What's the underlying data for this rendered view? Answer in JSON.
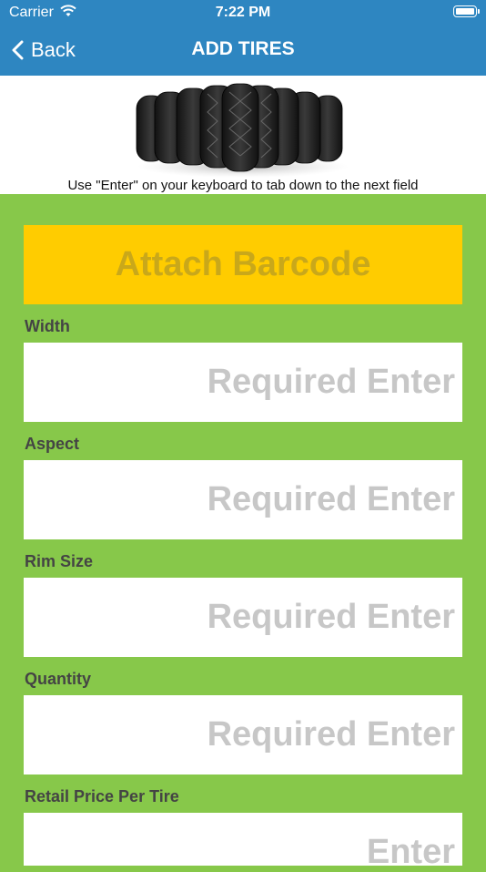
{
  "status_bar": {
    "carrier": "Carrier",
    "time": "7:22 PM"
  },
  "nav": {
    "back_label": "Back",
    "title": "ADD TIRES"
  },
  "hint": "Use \"Enter\" on your keyboard to tab down to the next field",
  "barcode_button": "Attach Barcode",
  "fields": [
    {
      "label": "Width",
      "placeholder": "Required Enter",
      "value": ""
    },
    {
      "label": "Aspect",
      "placeholder": "Required Enter",
      "value": ""
    },
    {
      "label": "Rim Size",
      "placeholder": "Required Enter",
      "value": ""
    },
    {
      "label": "Quantity",
      "placeholder": "Required Enter",
      "value": ""
    },
    {
      "label": "Retail Price Per Tire",
      "placeholder": "Enter",
      "value": ""
    }
  ],
  "colors": {
    "nav": "#2e86c1",
    "background": "#87c84a",
    "barcode_button": "#ffcc00",
    "barcode_text": "#c9a81a"
  }
}
